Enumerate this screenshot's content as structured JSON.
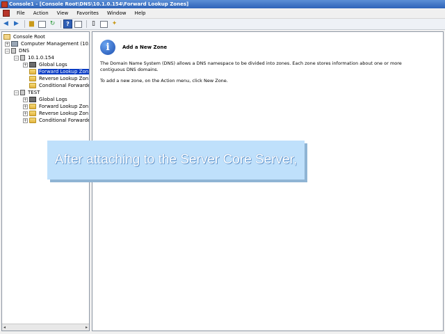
{
  "window": {
    "title": "Console1 - [Console Root\\DNS\\10.1.0.154\\Forward Lookup Zones]"
  },
  "menu": {
    "items": [
      "File",
      "Action",
      "View",
      "Favorites",
      "Window",
      "Help"
    ]
  },
  "toolbar": {
    "icons": [
      "back-arrow-icon",
      "forward-arrow-icon",
      "up-folder-icon",
      "show-hide-tree-icon",
      "refresh-icon",
      "help-icon",
      "properties-icon",
      "pane-icon",
      "new-zone-icon"
    ]
  },
  "tree": {
    "items": [
      {
        "label": "Console Root"
      },
      {
        "label": "Computer Management (10."
      },
      {
        "label": "DNS"
      },
      {
        "label": "10.1.0.154"
      },
      {
        "label": "Global Logs"
      },
      {
        "label": "Forward Lookup Zon"
      },
      {
        "label": "Reverse Lookup Zon"
      },
      {
        "label": "Conditional Forwarde"
      },
      {
        "label": "TEST"
      },
      {
        "label": "Global Logs"
      },
      {
        "label": "Forward Lookup Zon"
      },
      {
        "label": "Reverse Lookup Zon"
      },
      {
        "label": "Conditional Forwarde"
      }
    ],
    "selected_index": 5,
    "scroll_left": "◂",
    "scroll_right": "▸"
  },
  "result": {
    "heading": "Add a New Zone",
    "paragraph1": "The Domain Name System (DNS) allows a DNS namespace to be divided into zones. Each zone stores information about one or more contiguous DNS domains.",
    "paragraph2": "To add a new zone, on the Action menu, click New Zone."
  },
  "caption": {
    "text": "After attaching to the Server Core Server,"
  },
  "colors": {
    "title_bar": "#2e63b8",
    "selection": "#0a3cc4",
    "caption_bg": "#bfe0fb"
  }
}
